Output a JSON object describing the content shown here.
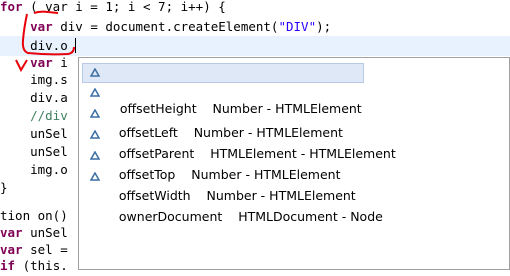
{
  "code": {
    "lines": [
      {
        "prefix": "",
        "kw": "for",
        "rest": " ( var i = 1; i < 7; i++) {"
      },
      {
        "prefix": "    ",
        "kw": "var",
        "rest": " div = document.createElement(",
        "str": "\"DIV\"",
        "tail": ");"
      },
      {
        "text": "    div.o"
      },
      {
        "prefix": "    ",
        "kw": "var",
        "rest": " i"
      },
      {
        "text": "    img.s"
      },
      {
        "text": "    div.a"
      },
      {
        "comment": "    //div"
      },
      {
        "text": "    unSel"
      },
      {
        "text": "    unSel"
      },
      {
        "text": "    img.o"
      },
      {
        "text": "}"
      },
      {
        "text": ""
      },
      {
        "text": "tion on()"
      },
      {
        "kw2": "var",
        "rest2": " unSel"
      },
      {
        "kw2": "var",
        "rest2": " sel ="
      },
      {
        "kw2": "if",
        "rest2": " (this."
      }
    ]
  },
  "autocomplete": {
    "items": [
      {
        "name": "offsetHeight",
        "type": "Number - HTMLElement",
        "icon": "field-icon"
      },
      {
        "name": "offsetLeft",
        "type": "Number - HTMLElement",
        "icon": "field-icon"
      },
      {
        "name": "offsetParent",
        "type": "HTMLElement - HTMLElement",
        "icon": "field-icon"
      },
      {
        "name": "offsetTop",
        "type": "Number - HTMLElement",
        "icon": "field-icon"
      },
      {
        "name": "offsetWidth",
        "type": "Number - HTMLElement",
        "icon": "field-icon"
      },
      {
        "name": "ownerDocument",
        "type": "HTMLDocument - Node",
        "icon": "field-icon"
      }
    ],
    "selected_index": 0
  },
  "colors": {
    "keyword": "#7f0055",
    "string": "#2a00ff",
    "comment": "#3f7f5f",
    "annotation": "#e8000b"
  }
}
